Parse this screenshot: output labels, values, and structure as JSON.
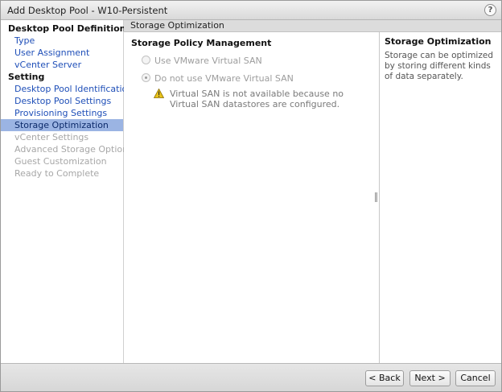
{
  "window": {
    "title": "Add Desktop Pool - W10-Persistent",
    "help_glyph": "?"
  },
  "sidebar": {
    "definition_heading": "Desktop Pool Definition",
    "definition_items": [
      {
        "label": "Type",
        "state": "link"
      },
      {
        "label": "User Assignment",
        "state": "link"
      },
      {
        "label": "vCenter Server",
        "state": "link"
      }
    ],
    "setting_heading": "Setting",
    "setting_items": [
      {
        "label": "Desktop Pool Identification",
        "state": "link"
      },
      {
        "label": "Desktop Pool Settings",
        "state": "link"
      },
      {
        "label": "Provisioning Settings",
        "state": "link"
      },
      {
        "label": "Storage Optimization",
        "state": "active"
      },
      {
        "label": "vCenter Settings",
        "state": "disabled"
      },
      {
        "label": "Advanced Storage Options",
        "state": "disabled"
      },
      {
        "label": "Guest Customization",
        "state": "disabled"
      },
      {
        "label": "Ready to Complete",
        "state": "disabled"
      }
    ]
  },
  "content": {
    "header": "Storage Optimization",
    "section_title": "Storage Policy Management",
    "options": [
      {
        "label": "Use VMware Virtual SAN",
        "checked": false,
        "enabled": false
      },
      {
        "label": "Do not use VMware Virtual SAN",
        "checked": true,
        "enabled": false
      }
    ],
    "warning": "Virtual SAN is not available because no Virtual SAN datastores are configured."
  },
  "help": {
    "title": "Storage Optimization",
    "body": "Storage can be optimized by storing different kinds of data separately."
  },
  "footer": {
    "back_label": "< Back",
    "next_label": "Next >",
    "cancel_label": "Cancel"
  },
  "colors": {
    "active_item_bg": "#9bb4e3",
    "link": "#1f4fb8",
    "warning_icon": "#e8c21a"
  }
}
